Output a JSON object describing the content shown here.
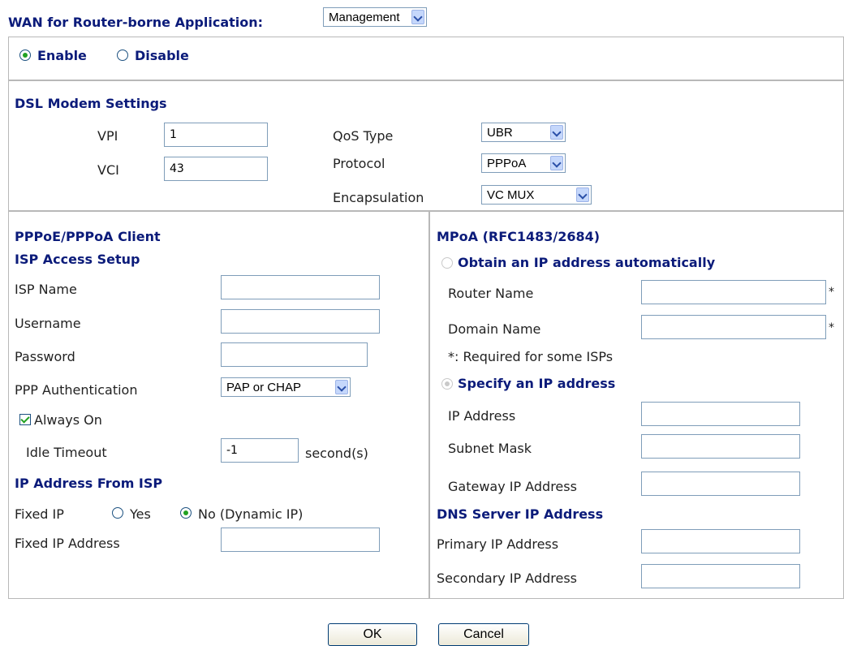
{
  "header": {
    "label": "WAN for Router-borne Application:",
    "app_value": "Management"
  },
  "state": {
    "enable_label": "Enable",
    "disable_label": "Disable"
  },
  "dsl": {
    "title": "DSL Modem Settings",
    "vpi_label": "VPI",
    "vpi_value": "1",
    "vci_label": "VCI",
    "vci_value": "43",
    "qos_label": "QoS Type",
    "qos_value": "UBR",
    "protocol_label": "Protocol",
    "protocol_value": "PPPoA",
    "encap_label": "Encapsulation",
    "encap_value": "VC MUX"
  },
  "ppp": {
    "title": "PPPoE/PPPoA Client",
    "isp_setup_title": "ISP Access Setup",
    "isp_name_label": "ISP Name",
    "isp_name_value": "",
    "username_label": "Username",
    "username_value": "",
    "password_label": "Password",
    "password_value": "",
    "auth_label": "PPP Authentication",
    "auth_value": "PAP or CHAP",
    "always_on_label": "Always On",
    "idle_label": "Idle Timeout",
    "idle_value": "-1",
    "idle_unit": "second(s)",
    "ip_from_isp_title": "IP Address From ISP",
    "fixed_ip_label": "Fixed IP",
    "yes_label": "Yes",
    "no_label": "No (Dynamic IP)",
    "fixed_ip_addr_label": "Fixed IP Address",
    "fixed_ip_addr_value": ""
  },
  "mpoa": {
    "title": "MPoA (RFC1483/2684)",
    "obtain_label": "Obtain an IP address automatically",
    "router_name_label": "Router Name",
    "router_name_value": "",
    "domain_name_label": "Domain Name",
    "domain_name_value": "",
    "star": "*",
    "required_note": "*: Required for some ISPs",
    "specify_label": "Specify an IP address",
    "ip_label": "IP Address",
    "ip_value": "",
    "mask_label": "Subnet Mask",
    "mask_value": "",
    "gateway_label": "Gateway IP Address",
    "gateway_value": "",
    "dns_title": "DNS Server IP Address",
    "primary_label": "Primary IP Address",
    "primary_value": "",
    "secondary_label": "Secondary IP Address",
    "secondary_value": ""
  },
  "buttons": {
    "ok": "OK",
    "cancel": "Cancel"
  }
}
